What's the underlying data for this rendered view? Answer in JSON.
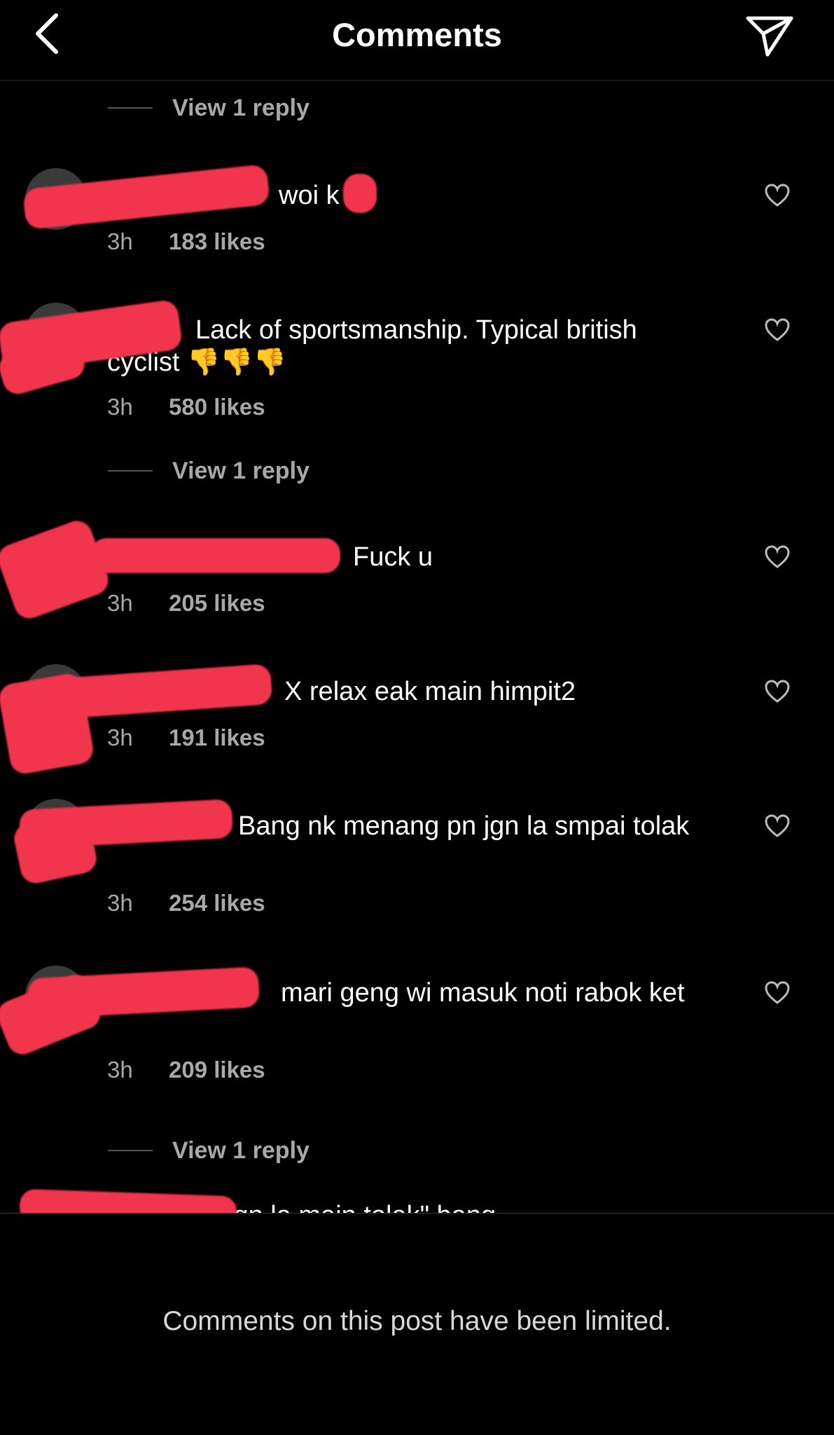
{
  "header": {
    "title": "Comments",
    "back_icon": "chevron-left-icon",
    "send_icon": "paper-plane-icon"
  },
  "view_reply_label": "View 1 reply",
  "comments": [
    {
      "text": "woi k    ak",
      "time": "3h",
      "likes": "183 likes"
    },
    {
      "text": "Lack of sportsmanship. Typical british cyclist 👎👎👎",
      "time": "3h",
      "likes": "580 likes"
    },
    {
      "text": "Fuck u",
      "time": "3h",
      "likes": "205 likes"
    },
    {
      "text": "X relax eak main himpit2",
      "time": "3h",
      "likes": "191 likes"
    },
    {
      "text": "Bang nk menang pn jgn la smpai tolak",
      "time": "3h",
      "likes": "254 likes"
    },
    {
      "text": "mari geng wi masuk noti rabok ket",
      "time": "3h",
      "likes": "209 likes"
    },
    {
      "text": "i jgn la main tolak\" bang"
    }
  ],
  "footer": {
    "limited_notice": "Comments on this post have been limited."
  },
  "colors": {
    "background": "#000000",
    "secondary_text": "#a8a8a8",
    "redaction": "#f0354d"
  }
}
